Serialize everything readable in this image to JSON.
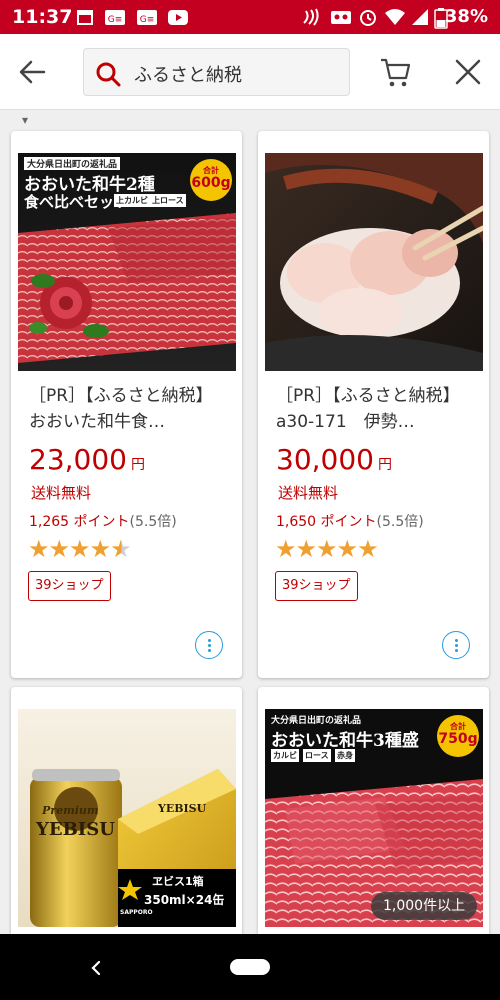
{
  "status_bar": {
    "time": "11:37",
    "battery": "38%"
  },
  "search": {
    "query": "ふるさと納税"
  },
  "products": [
    {
      "title": "［PR］【ふるさと納税】おおいた和牛食…",
      "price": "23,000",
      "currency": "円",
      "shipping": "送料無料",
      "points": "1,265 ポイント",
      "points_rate": "(5.5倍)",
      "rating_stars": 4.5,
      "shop_badge": "39ショップ",
      "image_text": {
        "origin": "大分県日出町の返礼品",
        "headline": "おおいた和牛2種",
        "sub": "食べ比べセット",
        "tag1": "上カルビ",
        "tag2": "上ロース",
        "total_label": "合計",
        "total": "600g"
      }
    },
    {
      "title": "［PR］【ふるさと納税】a30-171　伊勢…",
      "price": "30,000",
      "currency": "円",
      "shipping": "送料無料",
      "points": "1,650 ポイント",
      "points_rate": "(5.5倍)",
      "rating_stars": 5,
      "shop_badge": "39ショップ"
    },
    {
      "image_text": {
        "premium": "Premium",
        "brand": "YEBISU",
        "box_brand": "YEBISU",
        "sapporo": "SAPPORO",
        "box_label": "ヱビス1箱",
        "box_size": "350ml×24缶"
      }
    },
    {
      "image_text": {
        "origin": "大分県日出町の返礼品",
        "headline": "おおいた和牛3種盛",
        "tag1": "カルビ",
        "tag2": "ロース",
        "tag3": "赤身",
        "total_label": "合計",
        "total": "750g"
      }
    }
  ],
  "result_count": "1,000件以上",
  "colors": {
    "brand_red": "#bf0000",
    "status_bar": "#c3001f",
    "star": "#f0a030",
    "more_button": "#2b9bdb"
  }
}
